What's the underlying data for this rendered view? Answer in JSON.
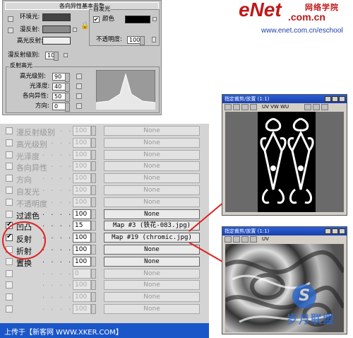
{
  "logo": {
    "brand": "eNet",
    "suffix": ".com.cn",
    "cn": "网络学院",
    "url": "www.enet.com.cn/eschool"
  },
  "panel": {
    "title": "各向异性基本参数",
    "ambient_label": "环境光:",
    "diffuse_label": "漫反射:",
    "specular_label": "高光反射:",
    "self_illum_group": "自发光",
    "color_label": "颜色",
    "opacity_label": "不透明度:",
    "opacity_value": "100",
    "diff_level_label": "漫反射级别:",
    "diff_level_value": "100",
    "spec_group": "反射高光",
    "spec_level_label": "高光级别:",
    "spec_level_value": "90",
    "gloss_label": "光泽度:",
    "gloss_value": "40",
    "aniso_label": "各向异性:",
    "aniso_value": "50",
    "orient_label": "方向:",
    "orient_value": "0"
  },
  "maps": [
    {
      "name": "漫反射级别",
      "amount": "100",
      "map": "None",
      "checked": false,
      "active": false
    },
    {
      "name": "高光级别",
      "amount": "100",
      "map": "None",
      "checked": false,
      "active": false
    },
    {
      "name": "光泽度",
      "amount": "100",
      "map": "None",
      "checked": false,
      "active": false
    },
    {
      "name": "各向异性",
      "amount": "100",
      "map": "None",
      "checked": false,
      "active": false
    },
    {
      "name": "方向",
      "amount": "100",
      "map": "None",
      "checked": false,
      "active": false
    },
    {
      "name": "自发光",
      "amount": "100",
      "map": "None",
      "checked": false,
      "active": false
    },
    {
      "name": "不透明度",
      "amount": "100",
      "map": "None",
      "checked": false,
      "active": false
    },
    {
      "name": "过滤色",
      "amount": "100",
      "map": "None",
      "checked": false,
      "active": true
    },
    {
      "name": "凹凸",
      "amount": "15",
      "map": "Map #3 (铁花-083.jpg)",
      "checked": true,
      "active": true
    },
    {
      "name": "反射",
      "amount": "100",
      "map": "Map #19 (chromic.jpg)",
      "checked": true,
      "active": true
    },
    {
      "name": "折射",
      "amount": "100",
      "map": "None",
      "checked": false,
      "active": true
    },
    {
      "name": "置换",
      "amount": "100",
      "map": "None",
      "checked": false,
      "active": true
    },
    {
      "name": "",
      "amount": "0",
      "map": "None",
      "checked": false,
      "active": false
    },
    {
      "name": "",
      "amount": "100",
      "map": "None",
      "checked": false,
      "active": false
    },
    {
      "name": "",
      "amount": "100",
      "map": "None",
      "checked": false,
      "active": false
    },
    {
      "name": "",
      "amount": "100",
      "map": "None",
      "checked": false,
      "active": false
    }
  ],
  "viewer_top": {
    "title": "指定裁剪/放置 (1:1)",
    "channels": "UV VW WU"
  },
  "viewer_bottom": {
    "title": "指定裁剪/放置 (1:1)",
    "channels": "UV"
  },
  "watermark": {
    "text": "岁月联盟"
  },
  "footer": {
    "text": "上传于【新客网 WWW.XKER.COM】"
  },
  "colors": {
    "annotation_red": "#e02020",
    "title_blue": "#1a3fa8"
  }
}
